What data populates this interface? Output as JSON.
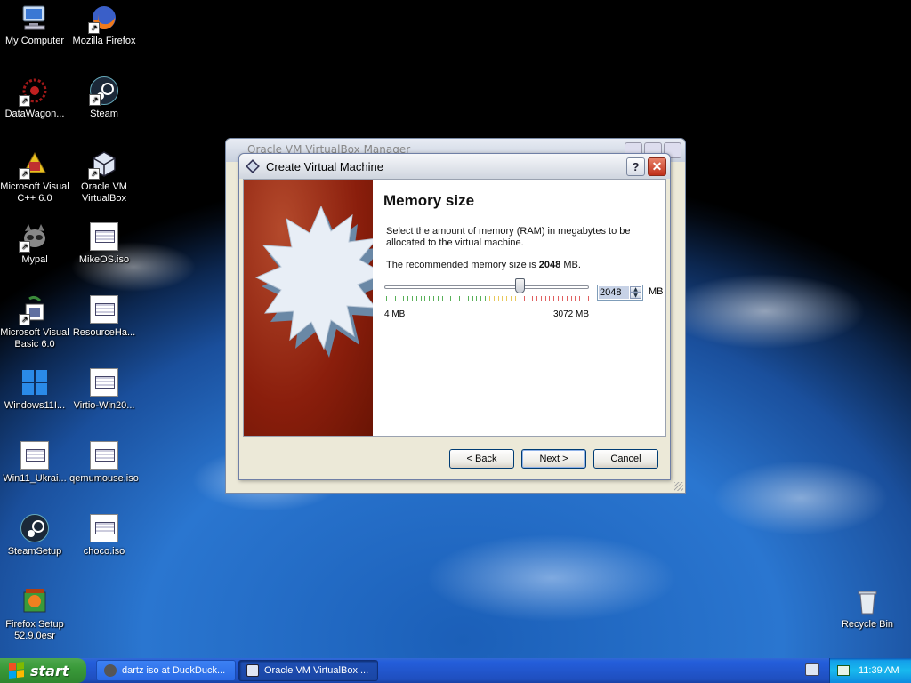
{
  "desktop": {
    "icons": [
      {
        "label": "My Computer"
      },
      {
        "label": "Mozilla Firefox"
      },
      {
        "label": "DataWagon..."
      },
      {
        "label": "Steam"
      },
      {
        "label": "Microsoft Visual C++ 6.0"
      },
      {
        "label": "Oracle VM VirtualBox"
      },
      {
        "label": "Mypal"
      },
      {
        "label": "MikeOS.iso"
      },
      {
        "label": "Microsoft Visual Basic 6.0"
      },
      {
        "label": "ResourceHa..."
      },
      {
        "label": "Windows11I..."
      },
      {
        "label": "Virtio-Win20..."
      },
      {
        "label": "Win11_Ukrai..."
      },
      {
        "label": "qemumouse.iso"
      },
      {
        "label": "SteamSetup"
      },
      {
        "label": "choco.iso"
      },
      {
        "label": "Firefox Setup 52.9.0esr"
      },
      {
        "label": "Recycle Bin"
      }
    ]
  },
  "manager": {
    "title": "Oracle VM VirtualBox Manager"
  },
  "dialog": {
    "title": "Create Virtual Machine",
    "help_label": "?",
    "close_label": "✕",
    "heading": "Memory size",
    "description": "Select the amount of memory (RAM) in megabytes to be allocated to the virtual machine.",
    "recommended_prefix": "The recommended memory size is ",
    "recommended_value": "2048",
    "recommended_suffix": " MB.",
    "memory": {
      "value": "2048",
      "unit": "MB",
      "min_label": "4 MB",
      "max_label": "3072 MB",
      "min": 4,
      "max": 3072,
      "current": 2048
    },
    "buttons": {
      "back": "< Back",
      "next": "Next >",
      "cancel": "Cancel"
    }
  },
  "taskbar": {
    "start_label": "start",
    "tasks": [
      {
        "label": "dartz iso at DuckDuck..."
      },
      {
        "label": "Oracle VM VirtualBox ..."
      }
    ],
    "clock": "11:39 AM"
  },
  "colors": {
    "taskbar_blue": "#245edb",
    "start_green": "#3a9a3a",
    "dialog_art_red": "#8a1e0c"
  }
}
